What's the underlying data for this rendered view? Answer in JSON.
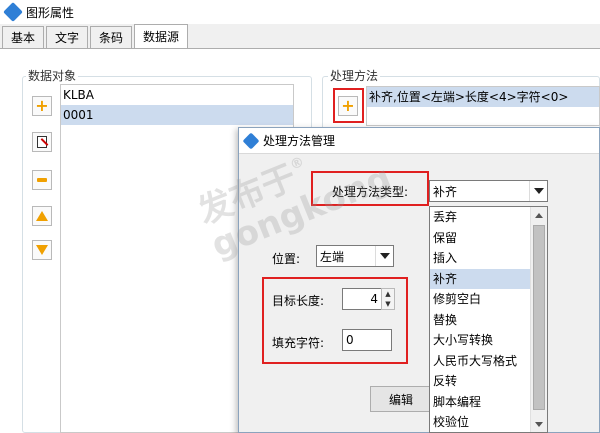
{
  "window": {
    "title": "图形属性"
  },
  "tabs": [
    {
      "label": "基本",
      "active": false
    },
    {
      "label": "文字",
      "active": false
    },
    {
      "label": "条码",
      "active": false
    },
    {
      "label": "数据源",
      "active": true
    }
  ],
  "data_objects": {
    "label": "数据对象",
    "items": [
      {
        "text": "KLBA",
        "selected": false
      },
      {
        "text": "0001",
        "selected": true
      }
    ],
    "buttons": [
      {
        "name": "add",
        "icon": "plus-icon"
      },
      {
        "name": "edit",
        "icon": "edit-icon"
      },
      {
        "name": "delete",
        "icon": "minus-icon"
      },
      {
        "name": "move-up",
        "icon": "arrow-up-icon"
      },
      {
        "name": "move-down",
        "icon": "arrow-down-icon"
      }
    ]
  },
  "processing": {
    "label": "处理方法",
    "items": [
      {
        "text": "补齐,位置<左端>长度<4>字符<0>"
      }
    ]
  },
  "dialog": {
    "title": "处理方法管理",
    "type_label": "处理方法类型:",
    "type_value": "补齐",
    "position_label": "位置:",
    "position_value": "左端",
    "length_label": "目标长度:",
    "length_value": "4",
    "fill_label": "填充字符:",
    "fill_value": "0",
    "edit_button": "编辑",
    "type_options": [
      "丢弃",
      "保留",
      "插入",
      "补齐",
      "修剪空白",
      "替换",
      "大小写转换",
      "人民币大写格式",
      "反转",
      "脚本编程",
      "校验位"
    ],
    "selected_option": "补齐"
  },
  "watermark": {
    "line1": "发布于",
    "line2": "gongkong",
    "mark": "®"
  },
  "colors": {
    "highlight_red": "#e02020",
    "selection": "#ccdbee",
    "icon_orange": "#f0a000"
  }
}
